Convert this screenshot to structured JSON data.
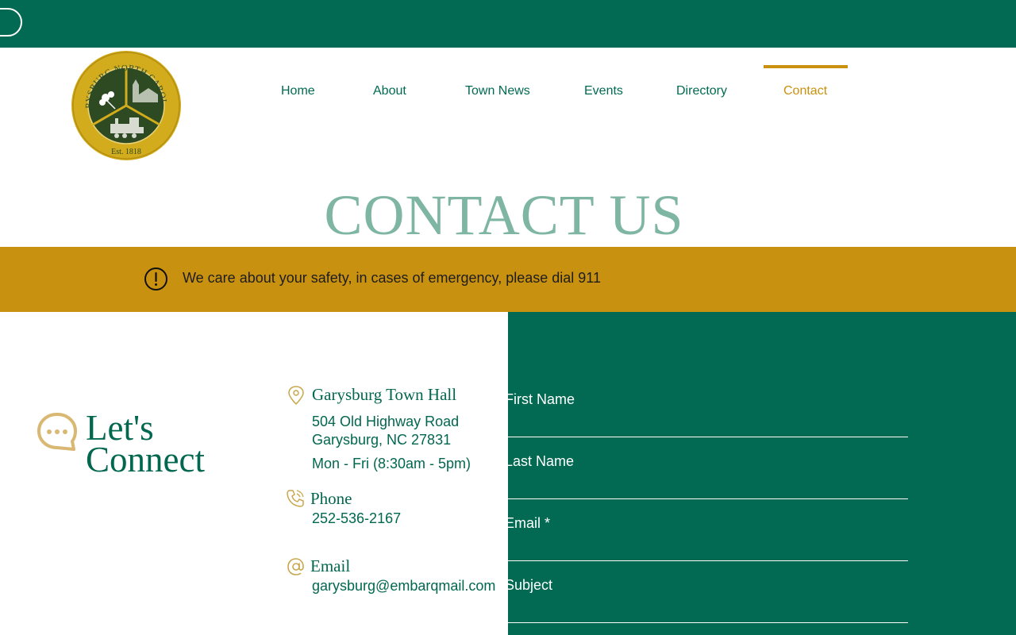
{
  "seal": {
    "ring_text": "GARYSBURG NORTH CAROLINA",
    "established": "Est. 1818"
  },
  "nav": {
    "items": [
      {
        "label": "Home"
      },
      {
        "label": "About"
      },
      {
        "label": "Town News"
      },
      {
        "label": "Events"
      },
      {
        "label": "Directory"
      },
      {
        "label": "Contact",
        "active": true
      }
    ]
  },
  "page": {
    "title": "CONTACT US"
  },
  "alert": {
    "icon": "exclamation-circle-icon",
    "text": "We care about your safety, in cases of emergency, please dial 911"
  },
  "connect": {
    "icon": "chat-bubble-icon",
    "line1": "Let's",
    "line2": "Connect"
  },
  "contact_info": {
    "location": {
      "icon": "map-pin-icon",
      "heading": "Garysburg Town Hall",
      "address_line1": "504 Old Highway Road",
      "address_line2": "Garysburg, NC 27831",
      "hours": "Mon - Fri  (8:30am - 5pm)"
    },
    "phone": {
      "icon": "phone-icon",
      "heading": "Phone",
      "number": "252-536-2167"
    },
    "email": {
      "icon": "at-sign-icon",
      "heading": "Email",
      "address": "garysburg@embarqmail.com"
    }
  },
  "form": {
    "fields": [
      {
        "label": "First Name"
      },
      {
        "label": "Last Name"
      },
      {
        "label": "Email *"
      },
      {
        "label": "Subject"
      }
    ]
  },
  "colors": {
    "brand_green": "#026a52",
    "accent_gold": "#c9910f",
    "title_teal": "#7fb6a3"
  }
}
